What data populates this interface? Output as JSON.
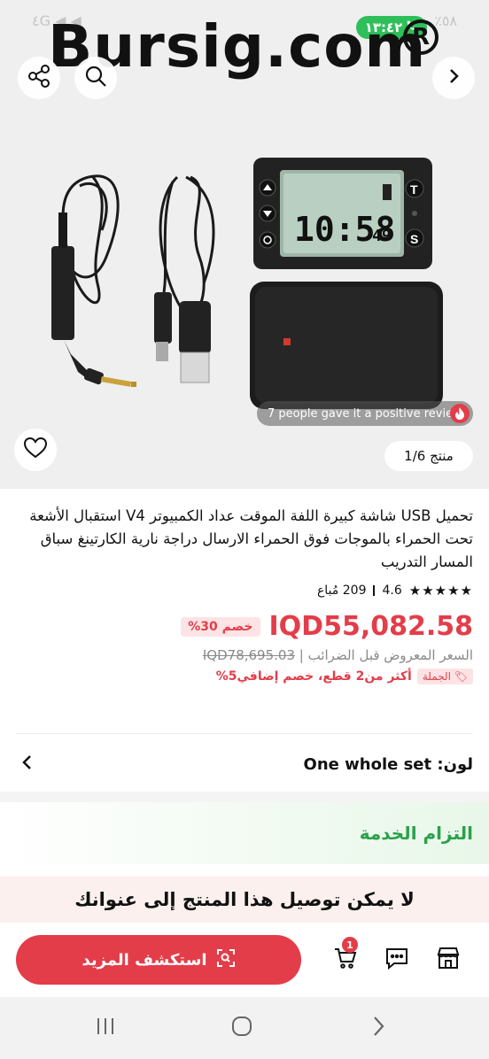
{
  "status": {
    "left_text": "٤G ◀ ◀",
    "call_time": "١٣:٤٢",
    "right_text": "٪٥٨"
  },
  "watermark": {
    "text": "Bursig.com",
    "reg_mark": "R"
  },
  "gallery": {
    "review_text": "7 people gave it a positive review",
    "counter": "منتج 1/6",
    "device_time": "10:58",
    "device_seconds": "49"
  },
  "product": {
    "title": "تحميل USB شاشة كبيرة اللفة الموقت عداد الكمبيوتر V4 استقبال الأشعة تحت الحمراء بالموجات فوق الحمراء الارسال دراجة نارية الكارتينغ سباق المسار التدريب",
    "rating_value": "4.6",
    "sold_text": "209 مُباع",
    "stars": "★★★★★",
    "price": "IQD55,082.58",
    "discount": "خصم 30%",
    "old_price": "IQD78,695.03",
    "old_price_label": "السعر المعروض قبل الضرائب",
    "bulk_badge": "الجملة",
    "bulk_text": "أكثر من2 قطع، خصم إضافي5%"
  },
  "color": {
    "label": "لون: One whole set"
  },
  "service": {
    "title": "التزام الخدمة"
  },
  "delivery": {
    "text": "لا يمكن توصيل هذا المنتج إلى عنوانك"
  },
  "bottom": {
    "explore_label": "استكشف المزيد",
    "cart_count": "1"
  },
  "colors": {
    "accent": "#e33d49",
    "service_green": "#2aa14a"
  }
}
